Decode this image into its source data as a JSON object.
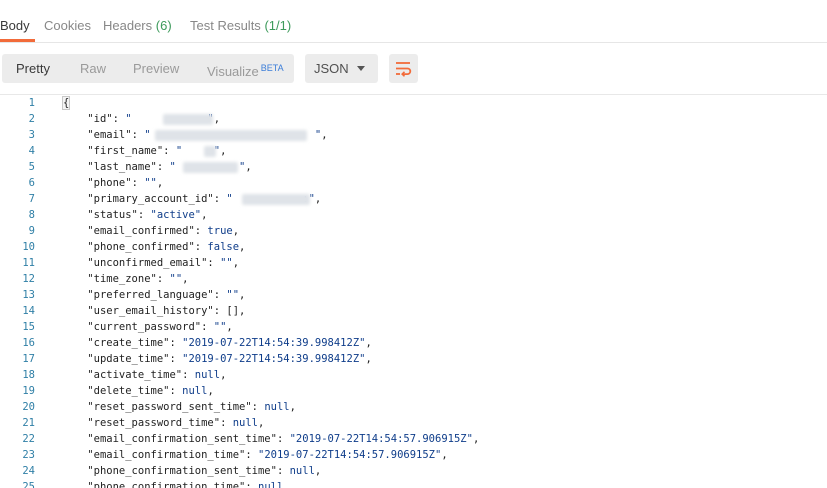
{
  "tabs": [
    {
      "label": "Body",
      "count": ""
    },
    {
      "label": "Cookies",
      "count": ""
    },
    {
      "label": "Headers",
      "count": "(6)"
    },
    {
      "label": "Test Results",
      "count": "(1/1)"
    }
  ],
  "toolbar": {
    "pretty": "Pretty",
    "raw": "Raw",
    "preview": "Preview",
    "visualize": "Visualize",
    "beta": "BETA",
    "format": "JSON",
    "wrap_icon": "wrap-lines-icon"
  },
  "colors": {
    "accent": "#f26b3a",
    "count_green": "#3d9a5b",
    "line_numbers": "#2f7fa6",
    "string": "#0f3d8a"
  },
  "lines": [
    {
      "n": "1",
      "text": "{"
    },
    {
      "n": "2",
      "text": "    \"id\": \"            \","
    },
    {
      "n": "3",
      "text": "    \"email\": \"                          \","
    },
    {
      "n": "4",
      "text": "    \"first_name\": \"     \","
    },
    {
      "n": "5",
      "text": "    \"last_name\": \"          \","
    },
    {
      "n": "6",
      "text": "    \"phone\": \"\","
    },
    {
      "n": "7",
      "text": "    \"primary_account_id\": \"           :\","
    },
    {
      "n": "8",
      "text": "    \"status\": \"active\","
    },
    {
      "n": "9",
      "text": "    \"email_confirmed\": true,"
    },
    {
      "n": "10",
      "text": "    \"phone_confirmed\": false,"
    },
    {
      "n": "11",
      "text": "    \"unconfirmed_email\": \"\","
    },
    {
      "n": "12",
      "text": "    \"time_zone\": \"\","
    },
    {
      "n": "13",
      "text": "    \"preferred_language\": \"\","
    },
    {
      "n": "14",
      "text": "    \"user_email_history\": [],"
    },
    {
      "n": "15",
      "text": "    \"current_password\": \"\","
    },
    {
      "n": "16",
      "text": "    \"create_time\": \"2019-07-22T14:54:39.998412Z\","
    },
    {
      "n": "17",
      "text": "    \"update_time\": \"2019-07-22T14:54:39.998412Z\","
    },
    {
      "n": "18",
      "text": "    \"activate_time\": null,"
    },
    {
      "n": "19",
      "text": "    \"delete_time\": null,"
    },
    {
      "n": "20",
      "text": "    \"reset_password_sent_time\": null,"
    },
    {
      "n": "21",
      "text": "    \"reset_password_time\": null,"
    },
    {
      "n": "22",
      "text": "    \"email_confirmation_sent_time\": \"2019-07-22T14:54:57.906915Z\","
    },
    {
      "n": "23",
      "text": "    \"email_confirmation_time\": \"2019-07-22T14:54:57.906915Z\","
    },
    {
      "n": "24",
      "text": "    \"phone_confirmation_sent_time\": null,"
    },
    {
      "n": "25",
      "text": "    \"phone_confirmation_time\": null"
    }
  ]
}
